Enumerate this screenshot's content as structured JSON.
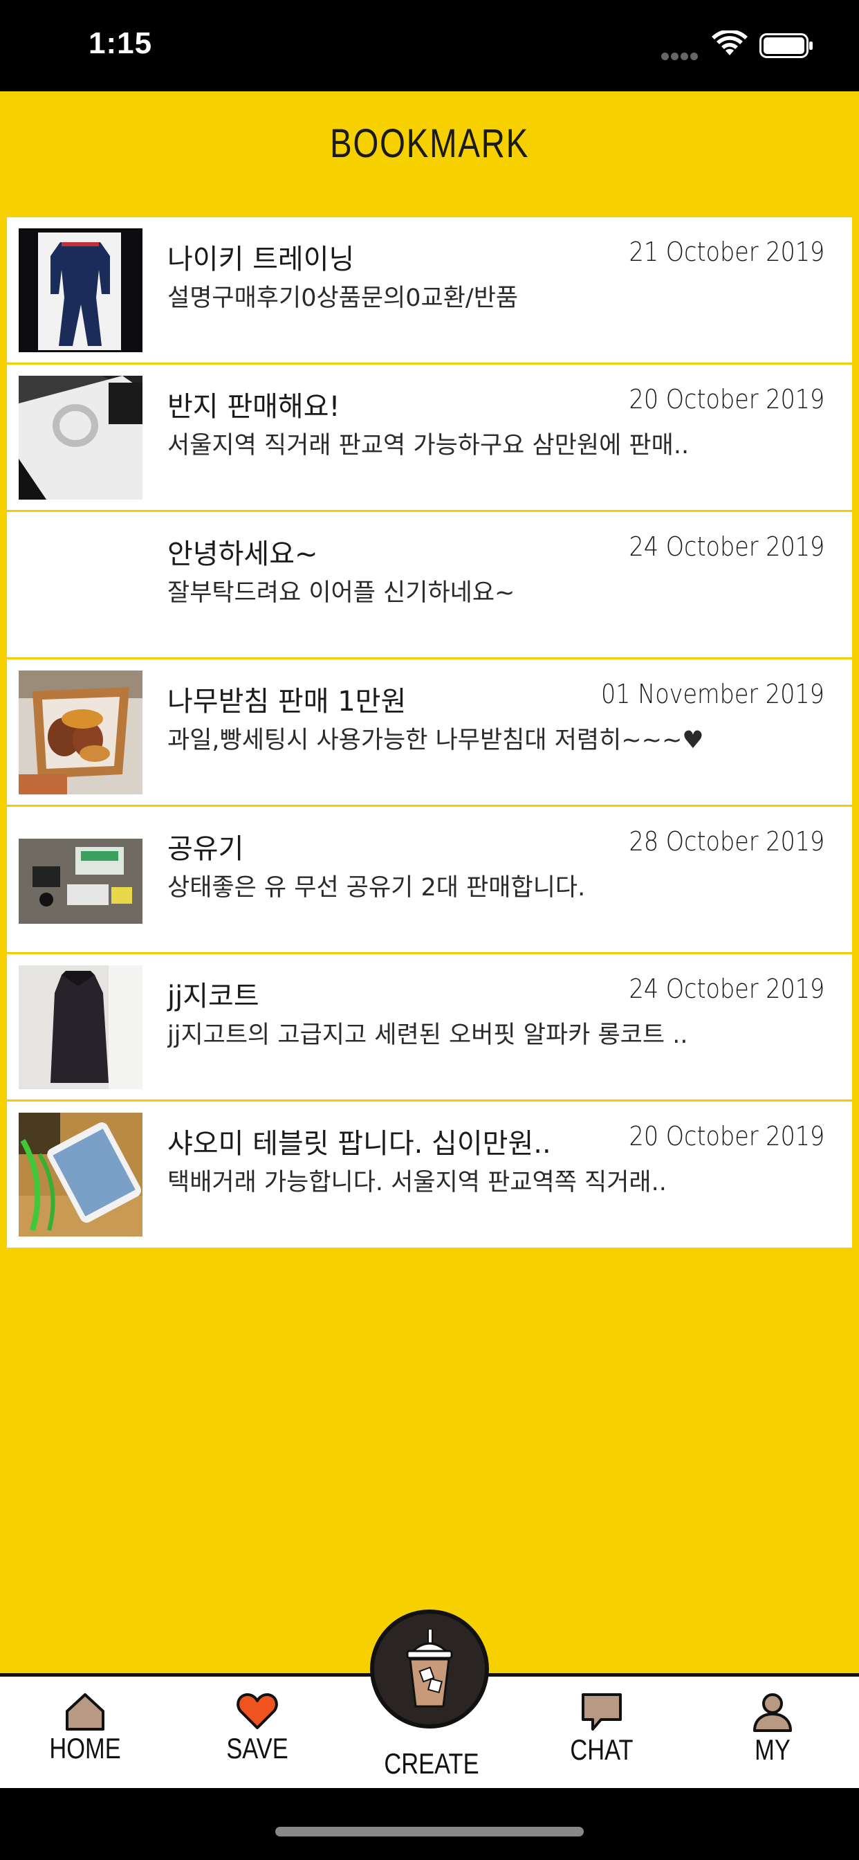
{
  "status_bar": {
    "time": "1:15"
  },
  "header": {
    "title": "BOOKMARK"
  },
  "bookmarks": [
    {
      "title": "나이키 트레이닝",
      "date": "21 October 2019",
      "desc": "설명구매후기0상품문의0교환/반품",
      "thumb": "tracksuit"
    },
    {
      "title": "반지 판매해요!",
      "date": "20 October 2019",
      "desc": "서울지역 직거래  판교역 가능하구요 삼만원에  판매..",
      "thumb": "ring"
    },
    {
      "title": "안녕하세요~",
      "date": "24 October 2019",
      "desc": "잘부탁드려요 이어플 신기하네요~",
      "thumb": "none"
    },
    {
      "title": "나무받침 판매 1만원",
      "date": "01 November 2019",
      "desc": "과일,빵세팅시 사용가능한 나무받침대 저렴히~~~♥",
      "thumb": "tray"
    },
    {
      "title": "공유기",
      "date": "28 October 2019",
      "desc": "상태좋은 유 무선 공유기 2대 판매합니다.",
      "thumb": "router"
    },
    {
      "title": "jj지코트",
      "date": "24 October 2019",
      "desc": "jj지고트의 고급지고 세련된 오버핏 알파카 롱코트 ..",
      "thumb": "coat"
    },
    {
      "title": "샤오미 테블릿  팝니다. 십이만원..",
      "date": "20 October 2019",
      "desc": "택배거래  가능합니다. 서울지역  판교역쪽  직거래..",
      "thumb": "tablet"
    }
  ],
  "tabbar": {
    "home": "HOME",
    "save": "SAVE",
    "create": "CREATE",
    "chat": "CHAT",
    "my": "MY"
  },
  "colors": {
    "accent": "#F7D000",
    "save_heart": "#F0541E",
    "icon_fill": "#B89A84"
  }
}
